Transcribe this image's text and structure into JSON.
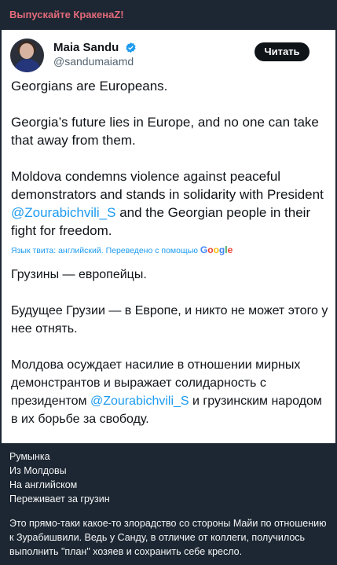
{
  "channel": {
    "title": "Выпускайте КракенаZ!"
  },
  "tweet": {
    "author_name": "Maia Sandu",
    "author_handle": "@sandumaiamd",
    "read_button": "Читать",
    "en": {
      "p1": "Georgians are Europeans.",
      "p2": "Georgia’s future lies in Europe, and no one can take that away from them.",
      "p3_before": "Moldova condemns violence against peaceful demonstrators and stands in solidarity with President ",
      "p3_mention": "@Zourabichvili_S",
      "p3_after": " and the Georgian people in their fight for freedom."
    },
    "translation_note": "Язык твита: английский. Переведено с помощью",
    "translation_brand": "Google",
    "ru": {
      "p1": "Грузины — европейцы.",
      "p2": "Будущее Грузии — в Европе, и никто не может этого у нее отнять.",
      "p3_before": "Молдова осуждает насилие в отношении мирных демонстрантов и выражает солидарность с президентом ",
      "p3_mention": "@Zourabichvili_S",
      "p3_after": " и грузинским народом в их борьбе за свободу."
    }
  },
  "caption": {
    "lines": [
      "Румынка",
      "Из Молдовы",
      "На английском",
      "Переживает за грузин"
    ],
    "paragraph": "Это прямо-таки какое-то злорадство со стороны Майи по отношению к Зурабишвили. Ведь у Санду, в отличие от коллеги, получилось выполнить \"план\" хозяев и сохранить себе кресло."
  },
  "colors": {
    "channel_title": "#e36a7a",
    "background": "#1c2733",
    "mention": "#1d9bf0",
    "verified": "#1d9bf0"
  }
}
